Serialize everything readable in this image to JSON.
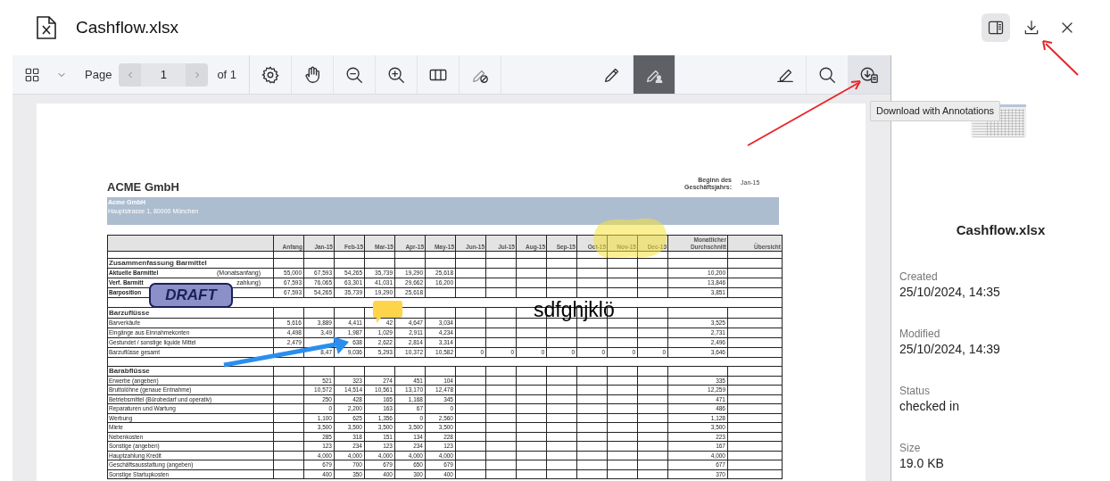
{
  "header": {
    "title": "Cashflow.xlsx",
    "tools": [
      {
        "kind": "sidebar-toggle",
        "selected": true
      },
      {
        "kind": "download",
        "selected": false
      },
      {
        "kind": "close",
        "selected": false
      }
    ]
  },
  "toolbar": {
    "page_label": "Page",
    "page_value": "1",
    "page_total": "of 1",
    "groups": [
      [
        {
          "kind": "settings",
          "selected": false,
          "hovered": false
        },
        {
          "kind": "hand",
          "selected": false,
          "hovered": false
        },
        {
          "kind": "zoom-out",
          "selected": false,
          "hovered": false
        },
        {
          "kind": "zoom-in",
          "selected": false,
          "hovered": false
        },
        {
          "kind": "columns",
          "selected": false,
          "hovered": false
        },
        {
          "kind": "hide-annotations",
          "selected": false,
          "hovered": false
        }
      ],
      [
        {
          "kind": "pencil",
          "selected": false,
          "hovered": false
        },
        {
          "kind": "pen-person",
          "selected": true,
          "hovered": false
        }
      ],
      [
        {
          "kind": "signature",
          "selected": false,
          "hovered": false
        },
        {
          "kind": "search",
          "selected": false,
          "hovered": false
        },
        {
          "kind": "download-annotations",
          "selected": false,
          "hovered": true
        }
      ]
    ]
  },
  "tooltip": "Download with Annotations",
  "sheet": {
    "company": "ACME GmbH",
    "band_name": "Acme GmbH",
    "band_address": "Hauptstrasse 1, 80000 München",
    "fiscal_label": "Beginn des Geschäftsjahrs:",
    "fiscal_value": "Jan-15",
    "columns": [
      "Anfang",
      "Jan-15",
      "Feb-15",
      "Mar-15",
      "Apr-15",
      "May-15",
      "Jun-15",
      "Jul-15",
      "Aug-15",
      "Sep-15",
      "Oct-15",
      "Nov-15",
      "Dec-15",
      "Monatlicher Durchschnitt",
      "Übersicht"
    ],
    "rows": [
      {
        "kind": "blank"
      },
      {
        "kind": "section",
        "label": "Zusammenfassung Barmittel"
      },
      {
        "kind": "data",
        "bold": true,
        "label": "Aktuelle Barmittel",
        "note": "(Monatsanfang)",
        "cells": {
          "anfang": "55,000",
          "jan": "67,593",
          "feb": "54,265",
          "mar": "35,739",
          "apr": "19,290",
          "may": "25,618",
          "average": "10,200"
        }
      },
      {
        "kind": "data",
        "bold": true,
        "label": "Verf. Barmitt",
        "note": "zahlung)",
        "cells": {
          "anfang": "67,593",
          "jan": "76,065",
          "feb": "63,301",
          "mar": "41,031",
          "apr": "29,662",
          "may": "16,200",
          "average": "13,846"
        }
      },
      {
        "kind": "data",
        "bold": true,
        "label": "Barposition",
        "cells": {
          "anfang": "67,593",
          "jan": "54,265",
          "feb": "35,739",
          "mar": "19,290",
          "apr": "25,618",
          "average": "3,851"
        }
      },
      {
        "kind": "gap"
      },
      {
        "kind": "section",
        "label": "Barzuflüsse"
      },
      {
        "kind": "data",
        "bold": false,
        "label": "Barverkäufe",
        "cells": {
          "anfang": "5,616",
          "jan": "3,889",
          "feb": "4,411",
          "mar": "42",
          "apr": "4,647",
          "may": "3,034",
          "average": "3,525"
        }
      },
      {
        "kind": "data",
        "bold": false,
        "label": "Eingänge aus Einnahmekonten",
        "cells": {
          "anfang": "4,498",
          "jan": "3,49",
          "feb": "1,987",
          "mar": "1,029",
          "apr": "2,911",
          "may": "4,234",
          "average": "2,731"
        }
      },
      {
        "kind": "data",
        "bold": false,
        "label": "Gestundet / sonstige liquide Mittel",
        "cells": {
          "anfang": "2,479",
          "feb": "638",
          "mar": "2,622",
          "apr": "2,814",
          "may": "3,314",
          "average": "2,496"
        }
      },
      {
        "kind": "data",
        "bold": false,
        "label": "Barzuflüsse gesamt",
        "cells": {
          "jan": "8,47",
          "feb": "9,036",
          "mar": "5,293",
          "apr": "10,372",
          "may": "10,582",
          "jun": "0",
          "jul": "0",
          "aug": "0",
          "sep": "0",
          "oct": "0",
          "nov": "0",
          "dec": "0",
          "average": "3,646"
        }
      },
      {
        "kind": "gap"
      },
      {
        "kind": "section",
        "label": "Barabflüsse"
      },
      {
        "kind": "data",
        "bold": false,
        "label": "Erwerbe (angeben)",
        "cells": {
          "jan": "521",
          "feb": "323",
          "mar": "274",
          "apr": "451",
          "may": "104",
          "average": "335"
        }
      },
      {
        "kind": "data",
        "bold": false,
        "label": "Bruttolöhne (genaue Entnahme)",
        "cells": {
          "jan": "10,572",
          "feb": "14,514",
          "mar": "10,561",
          "apr": "13,170",
          "may": "12,478",
          "average": "12,259"
        }
      },
      {
        "kind": "data",
        "bold": false,
        "label": "Betriebsmittel (Bürobedarf und operativ)",
        "cells": {
          "jan": "250",
          "feb": "428",
          "mar": "165",
          "apr": "1,168",
          "may": "345",
          "average": "471"
        }
      },
      {
        "kind": "data",
        "bold": false,
        "label": "Reparaturen und Wartung",
        "cells": {
          "jan": "0",
          "feb": "2,200",
          "mar": "163",
          "apr": "67",
          "may": "0",
          "average": "486"
        }
      },
      {
        "kind": "data",
        "bold": false,
        "label": "Werbung",
        "cells": {
          "jan": "1,100",
          "feb": "625",
          "mar": "1,356",
          "apr": "0",
          "may": "2,560",
          "average": "1,128"
        }
      },
      {
        "kind": "data",
        "bold": false,
        "label": "Miete",
        "cells": {
          "jan": "3,500",
          "feb": "3,500",
          "mar": "3,500",
          "apr": "3,500",
          "may": "3,500",
          "average": "3,500"
        }
      },
      {
        "kind": "data",
        "bold": false,
        "label": "Nebenkosten",
        "cells": {
          "jan": "285",
          "feb": "318",
          "mar": "151",
          "apr": "134",
          "may": "228",
          "average": "223"
        }
      },
      {
        "kind": "data",
        "bold": false,
        "label": "Sonstige (angeben)",
        "cells": {
          "jan": "123",
          "feb": "234",
          "mar": "123",
          "apr": "234",
          "may": "123",
          "average": "167"
        }
      },
      {
        "kind": "data",
        "bold": false,
        "label": "Hauptzahlung Kredit",
        "cells": {
          "jan": "4,000",
          "feb": "4,000",
          "mar": "4,000",
          "apr": "4,000",
          "may": "4,000",
          "average": "4,000"
        }
      },
      {
        "kind": "data",
        "bold": false,
        "label": "Geschäftsausstattung (angeben)",
        "cells": {
          "jan": "679",
          "feb": "700",
          "mar": "679",
          "apr": "650",
          "may": "679",
          "average": "677"
        }
      },
      {
        "kind": "data",
        "bold": false,
        "label": "Sonstige Startupkosten",
        "cells": {
          "jan": "400",
          "feb": "350",
          "mar": "400",
          "apr": "300",
          "may": "400",
          "average": "370"
        }
      }
    ]
  },
  "annotations": [
    {
      "kind": "highlight"
    },
    {
      "kind": "stamp",
      "text": "DRAFT"
    },
    {
      "kind": "note"
    },
    {
      "kind": "arrow"
    },
    {
      "kind": "free-text",
      "text": "sdfghjklö"
    }
  ],
  "panel": {
    "name": "Cashflow.xlsx",
    "fields": [
      {
        "label": "Created",
        "value": "25/10/2024, 14:35"
      },
      {
        "label": "Modified",
        "value": "25/10/2024, 14:39"
      },
      {
        "label": "Status",
        "value": "checked in"
      },
      {
        "label": "Size",
        "value": "19.0 KB"
      }
    ]
  }
}
